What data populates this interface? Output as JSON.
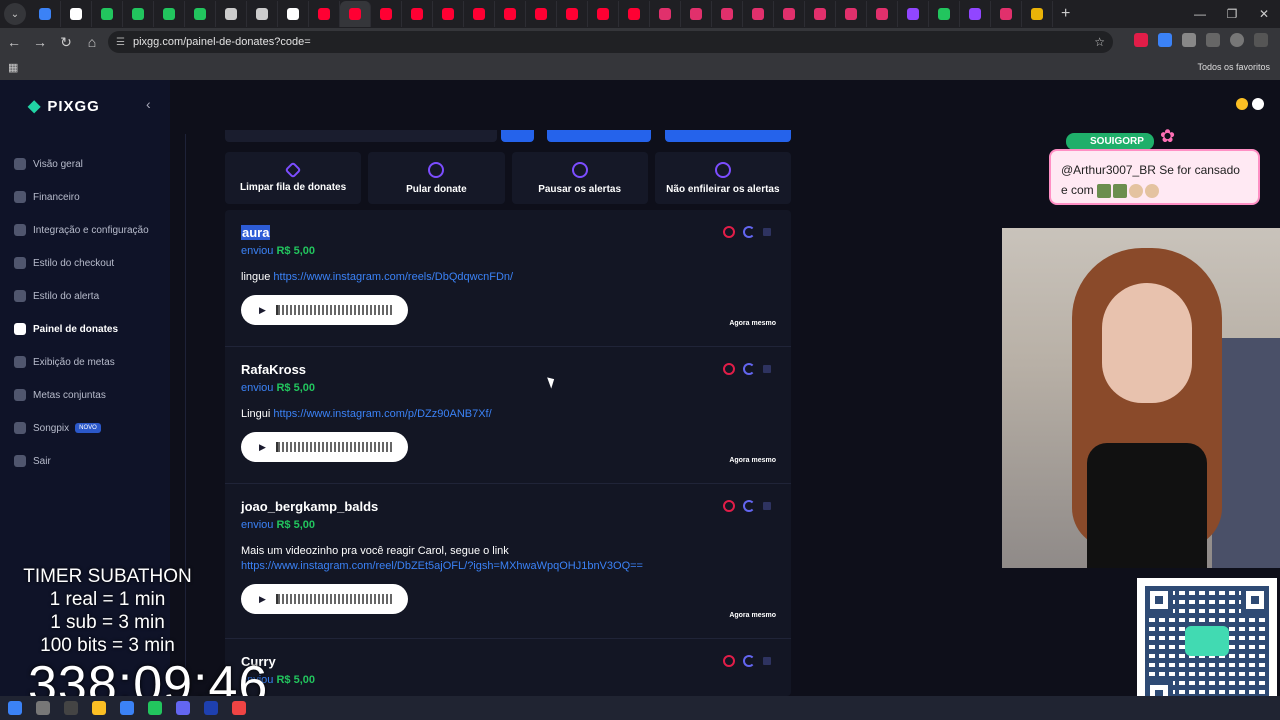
{
  "browser": {
    "url": "pixgg.com/painel-de-donates?code=",
    "bookmarks_label": "Todos os favoritos",
    "tab_colors": [
      "#3b82f6",
      "#ffffff",
      "#22c55e",
      "#22c55e",
      "#22c55e",
      "#22c55e",
      "#cccccc",
      "#cccccc",
      "#ffffff",
      "#ff0033",
      "#ff0033",
      "#ff0033",
      "#ff0033",
      "#ff0033",
      "#ff0033",
      "#ff0033",
      "#ff0033",
      "#ff0033",
      "#ff0033",
      "#ff0033",
      "#e1306c",
      "#e1306c",
      "#e1306c",
      "#e1306c",
      "#e1306c",
      "#e1306c",
      "#e1306c",
      "#e1306c",
      "#9146ff",
      "#22c55e",
      "#9146ff",
      "#e1306c",
      "#eab308"
    ]
  },
  "sidebar": {
    "logo": "PIXGG",
    "items": [
      {
        "label": "Visão geral"
      },
      {
        "label": "Financeiro"
      },
      {
        "label": "Integração e configuração"
      },
      {
        "label": "Estilo do checkout"
      },
      {
        "label": "Estilo do alerta"
      },
      {
        "label": "Painel de donates"
      },
      {
        "label": "Exibição de metas"
      },
      {
        "label": "Metas conjuntas"
      },
      {
        "label": "Songpix",
        "badge": "NOVO"
      },
      {
        "label": "Sair"
      }
    ]
  },
  "actions": [
    {
      "label": "Limpar fila de donates"
    },
    {
      "label": "Pular donate"
    },
    {
      "label": "Pausar os alertas"
    },
    {
      "label": "Não enfileirar os alertas"
    }
  ],
  "donates": [
    {
      "name": "aura",
      "sent": "enviou",
      "amount": "R$ 5,00",
      "msg": "lingue ",
      "link": "https://www.instagram.com/reels/DbQdqwcnFDn/",
      "time": "Agora mesmo"
    },
    {
      "name": "RafaKross",
      "sent": "enviou",
      "amount": "R$ 5,00",
      "msg": "Lingui ",
      "link": "https://www.instagram.com/p/DZz90ANB7Xf/",
      "time": "Agora mesmo"
    },
    {
      "name": "joao_bergkamp_balds",
      "sent": "enviou",
      "amount": "R$ 5,00",
      "msg": "Mais um videozinho pra você reagir Carol, segue o link",
      "link": "https://www.instagram.com/reel/DbZEt5ajOFL/?igsh=MXhwaWpqOHJ1bnV3OQ==",
      "time": "Agora mesmo"
    },
    {
      "name": "Curry",
      "sent": "enviou",
      "amount": "R$ 5,00",
      "msg": "",
      "link": "",
      "time": ""
    }
  ],
  "overlay": {
    "alert_tag": "SOUIGORP",
    "alert_text_1": "@Arthur3007_BR Se for cansado",
    "alert_text_2": "e com",
    "timer_lines": [
      "TIMER SUBATHON",
      "1 real = 1 min",
      "1 sub = 3 min",
      "100 bits = 3 min"
    ],
    "timer_value": "338:09:46"
  }
}
